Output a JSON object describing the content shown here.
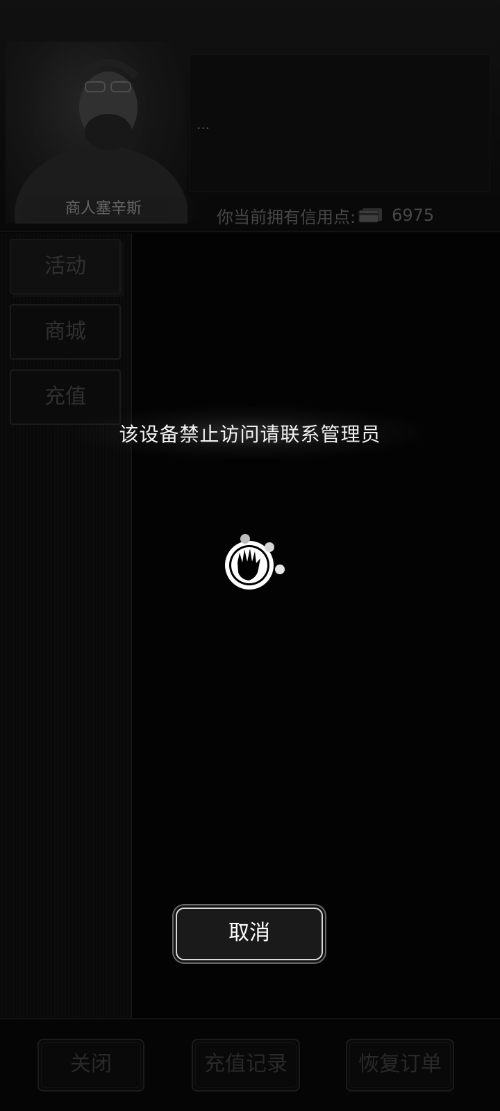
{
  "merchant": {
    "name": "商人塞辛斯",
    "dialog": "..."
  },
  "credits": {
    "label": "你当前拥有信用点:",
    "value": "6975"
  },
  "sidebar": {
    "items": [
      {
        "label": "活动"
      },
      {
        "label": "商城"
      },
      {
        "label": "充值"
      }
    ]
  },
  "footer": {
    "close": "关闭",
    "recharge_history": "充值记录",
    "restore_orders": "恢复订单"
  },
  "modal": {
    "message": "该设备禁止访问请联系管理员",
    "cancel": "取消"
  }
}
